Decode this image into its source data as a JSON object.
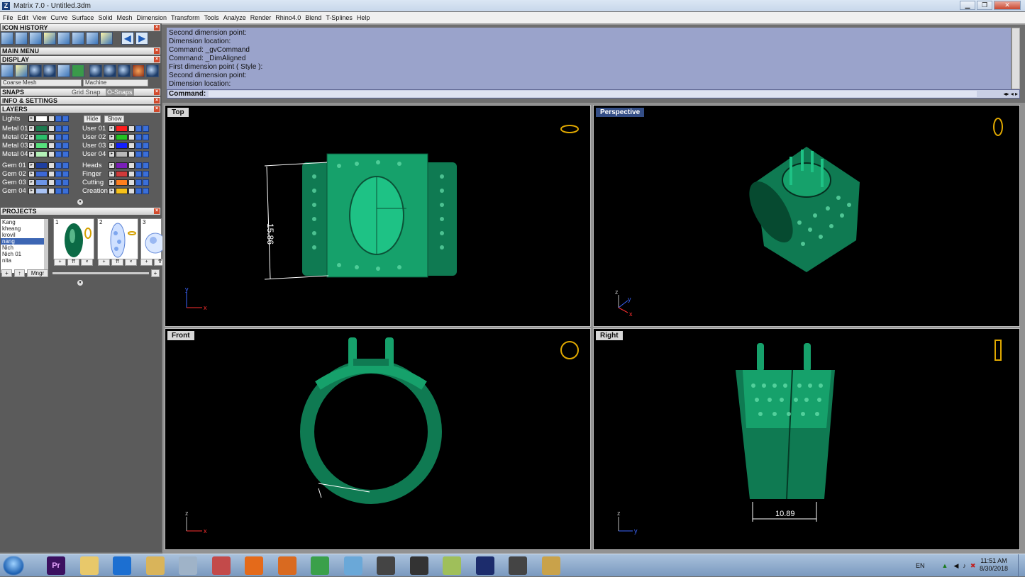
{
  "window": {
    "title": "Matrix 7.0 - Untitled.3dm",
    "icon": "Z",
    "buttons": [
      "minimize",
      "restore",
      "close"
    ]
  },
  "menu": [
    "File",
    "Edit",
    "View",
    "Curve",
    "Surface",
    "Solid",
    "Mesh",
    "Dimension",
    "Transform",
    "Tools",
    "Analyze",
    "Render",
    "Rhino4.0",
    "Blend",
    "T-Splines",
    "Help"
  ],
  "panel": {
    "icon_history": "ICON HISTORY",
    "main_menu": "MAIN MENU",
    "display": "DISPLAY",
    "mesh_select": "Coarse Mesh",
    "material_select": "Machine",
    "snaps": "SNAPS",
    "grid_snap": "Grid Snap",
    "osnaps": "O-Snaps",
    "info": "INFO & SETTINGS",
    "layers": "LAYERS",
    "lights": "Lights",
    "hide": "Hide",
    "show": "Show",
    "layers_left": [
      {
        "name": "Metal 01",
        "color": "#1c7a4f"
      },
      {
        "name": "Metal 02",
        "color": "#2bbf6b"
      },
      {
        "name": "Metal 03",
        "color": "#57e07d"
      },
      {
        "name": "Metal 04",
        "color": "#b4f2b8"
      },
      {
        "name": "Gem 01",
        "color": "#1e3fa0"
      },
      {
        "name": "Gem 02",
        "color": "#3c68d6"
      },
      {
        "name": "Gem 03",
        "color": "#6c95e8"
      },
      {
        "name": "Gem 04",
        "color": "#a9c3f4"
      }
    ],
    "layers_right": [
      {
        "name": "User 01",
        "color": "#ff1e1e"
      },
      {
        "name": "User 02",
        "color": "#22c322"
      },
      {
        "name": "User 03",
        "color": "#1320ff"
      },
      {
        "name": "User 04",
        "color": "#b8b8b8"
      },
      {
        "name": "Heads",
        "color": "#7a1fb8"
      },
      {
        "name": "Finger",
        "color": "#d03a3a"
      },
      {
        "name": "Cutting",
        "color": "#ff7f1e"
      },
      {
        "name": "Creation",
        "color": "#f7c21a"
      }
    ],
    "projects": "PROJECTS",
    "project_list": [
      "Kang",
      "kheang",
      "krovil",
      "nang",
      "Nich",
      "Nich 01",
      "nita"
    ],
    "project_selected": "nang",
    "thumb_numbers": [
      "1",
      "2",
      "3"
    ],
    "mngr": "Mngr"
  },
  "history": [
    "Second dimension point:",
    "Dimension location:",
    "Command: _gvCommand",
    "Command: _DimAligned",
    "First dimension point ( Style ):",
    "Second dimension point:",
    "Dimension location:"
  ],
  "command_label": "Command:",
  "viewports": [
    {
      "label": "Top",
      "dim": "15.86",
      "axes": [
        "y",
        "x"
      ]
    },
    {
      "label": "Perspective",
      "axes": [
        "z",
        "y",
        "x"
      ]
    },
    {
      "label": "Front",
      "axes": [
        "z",
        "x"
      ]
    },
    {
      "label": "Right",
      "dim": "10.89",
      "axes": [
        "z",
        "y"
      ]
    }
  ],
  "taskbar": {
    "apps": [
      "Pr",
      "Explorer",
      "IE",
      "Folder",
      "Calculator",
      "Snipping",
      "Firefox",
      "Media",
      "Chrome",
      "Eraser",
      "Pen",
      "Zbrush",
      "Notes",
      "Matrix",
      "Rhino",
      "Paint"
    ],
    "lang": "EN",
    "time": "11:51 AM",
    "date": "8/30/2018"
  }
}
